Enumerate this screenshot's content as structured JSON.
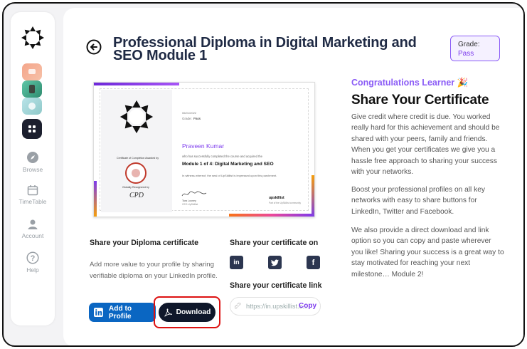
{
  "page": {
    "title": "Professional Diploma in Digital Marketing and SEO Module 1",
    "grade_label": "Grade:",
    "grade_value": "Pass"
  },
  "sidebar": {
    "items": [
      {
        "label": "Browse",
        "icon": "compass-icon"
      },
      {
        "label": "TimeTable",
        "icon": "calendar-icon"
      },
      {
        "label": "Account",
        "icon": "user-icon"
      },
      {
        "label": "Help",
        "icon": "help-icon"
      }
    ]
  },
  "certificate": {
    "date": "06/01/2022",
    "grade_label": "Grade:",
    "grade_value": "Pass",
    "awarded_by": "Certificate of Completion Awarded by",
    "recipient": "Praveen Kumar",
    "completed_text": "who has successfully completed the course and acquired the",
    "module": "Module 1 of 4: Digital Marketing and SEO",
    "witness_text": "In witness whereof, the seal of UpSkillist is impressed upon this parchment.",
    "recognized_by": "Globally Recognized by",
    "signatory_name": "Tara Looney",
    "signatory_role": "CEO UpSkillist",
    "brand": "upskillist",
    "brand_tagline": "Part of the UpSkillist community"
  },
  "right": {
    "congrats": "Congratulations Learner 🎉",
    "heading": "Share Your Certificate",
    "p1": "Give credit where credit is due. You worked really hard for this achievement and should be shared with your peers, family and friends. When you get your certificates we give you a hassle free approach to sharing your success with your networks.",
    "p2": "Boost your professional profiles on all key networks with easy to share buttons for LinkedIn, Twitter and Facebook.",
    "p3": "We also provide a direct download and link option so you can copy and paste wherever you like! Sharing your success is a great way to stay motivated for reaching your next milestone… Module 2!"
  },
  "share": {
    "diploma_heading": "Share your Diploma certificate",
    "diploma_text": "Add more value to your profile by sharing verifiable diploma on your LinkedIn profile.",
    "add_profile_label": "Add to Profile",
    "download_label": "Download",
    "share_on_heading": "Share your certificate on",
    "link_heading": "Share your certificate link",
    "link_value": "https://in.upskillist.c...",
    "copy_label": "Copy"
  },
  "colors": {
    "accent": "#8b5cf6",
    "linkedin": "#0a66c2",
    "dark": "#0f172a",
    "highlight": "#dd1111"
  }
}
